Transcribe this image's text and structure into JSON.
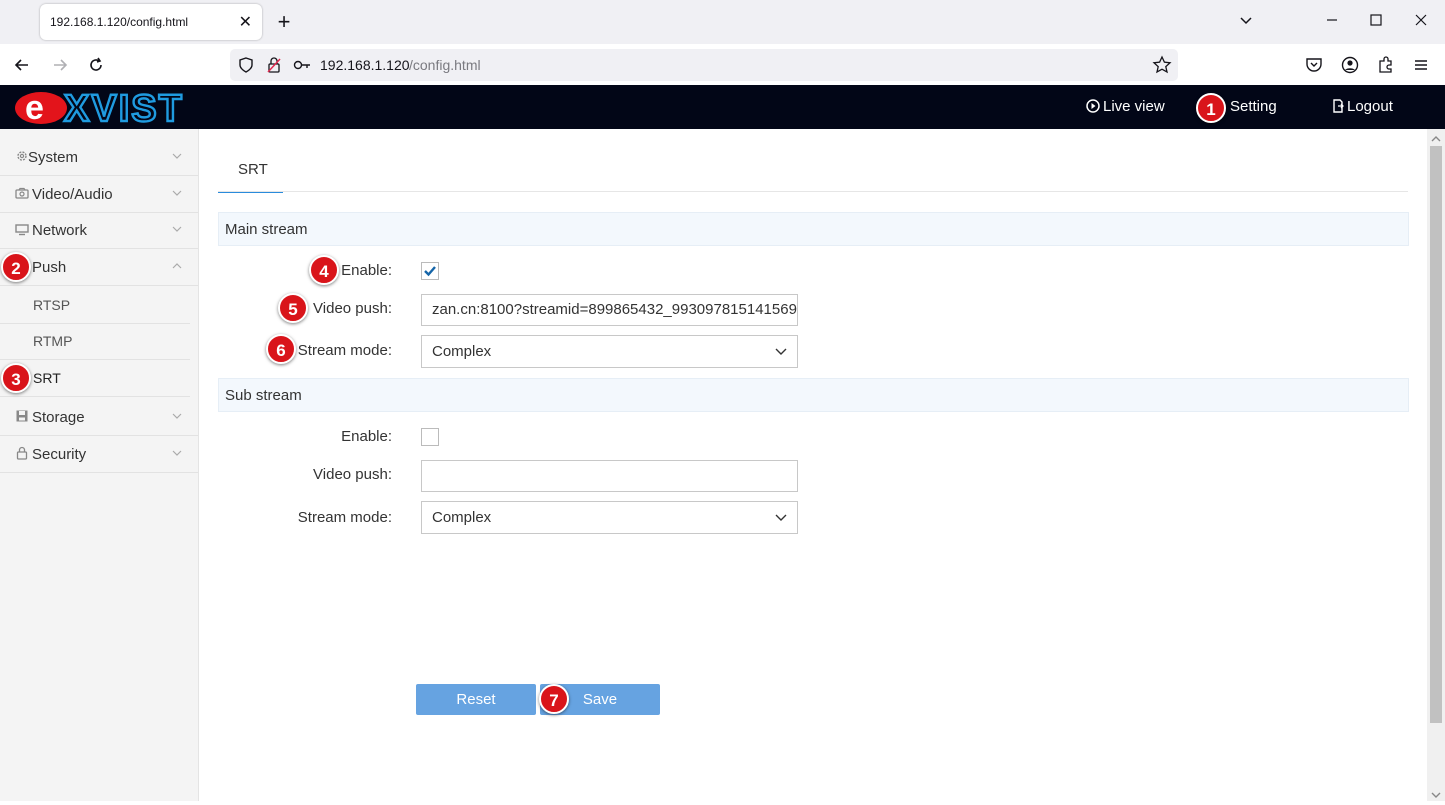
{
  "browser": {
    "tab_title": "192.168.1.120/config.html",
    "new_tab_glyph": "+",
    "url_host": "192.168.1.120",
    "url_path": "/config.html"
  },
  "header": {
    "logo": "eXVIST",
    "live_view": "Live view",
    "setting": "Setting",
    "logout": "Logout"
  },
  "sidebar": {
    "items": [
      {
        "label": "System",
        "icon": "gear-icon"
      },
      {
        "label": "Video/Audio",
        "icon": "camera-icon"
      },
      {
        "label": "Network",
        "icon": "monitor-icon"
      },
      {
        "label": "Push",
        "icon": "push-icon",
        "expanded": true
      },
      {
        "label": "Storage",
        "icon": "floppy-icon"
      },
      {
        "label": "Security",
        "icon": "lock-icon"
      }
    ],
    "push_sub": [
      "RTSP",
      "RTMP",
      "SRT"
    ],
    "selected": "SRT"
  },
  "content": {
    "tab": "SRT",
    "main_stream": {
      "title": "Main stream",
      "enable_label": "Enable:",
      "enabled": true,
      "video_push_label": "Video push:",
      "video_push_value": "zan.cn:8100?streamid=899865432_993097815141569",
      "stream_mode_label": "Stream mode:",
      "stream_mode_value": "Complex"
    },
    "sub_stream": {
      "title": "Sub stream",
      "enable_label": "Enable:",
      "enabled": false,
      "video_push_label": "Video push:",
      "video_push_value": "",
      "stream_mode_label": "Stream mode:",
      "stream_mode_value": "Complex"
    },
    "reset_label": "Reset",
    "save_label": "Save"
  },
  "annotations": [
    "1",
    "2",
    "3",
    "4",
    "5",
    "6",
    "7"
  ],
  "colors": {
    "header_bg": "#020617",
    "accent": "#2a8bdc",
    "button": "#66a3e1",
    "badge": "#d9141a",
    "logo_red": "#e3141b",
    "logo_blue": "#1f9be0"
  }
}
